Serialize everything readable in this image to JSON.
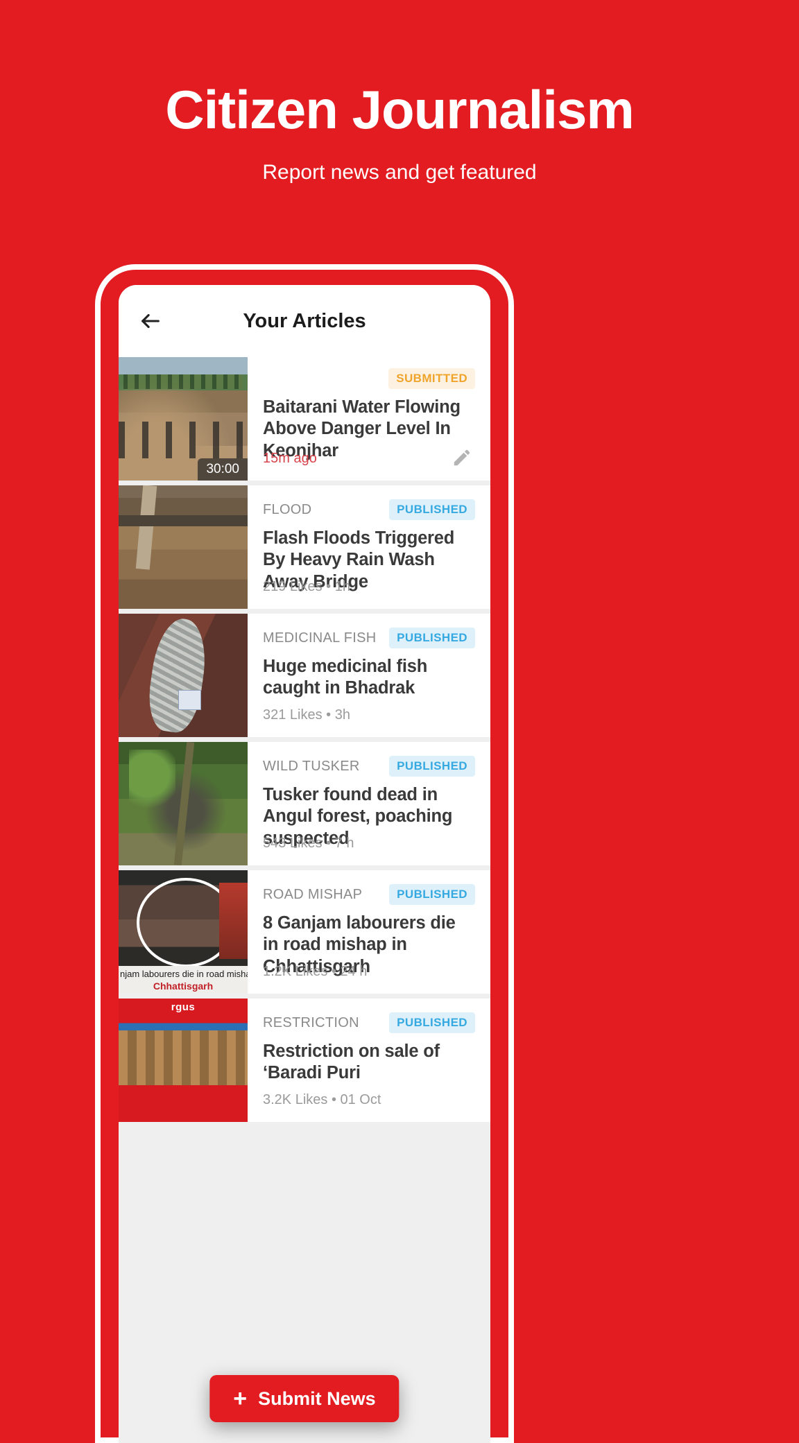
{
  "promo": {
    "title": "Citizen Journalism",
    "subtitle": "Report news and get featured"
  },
  "colors": {
    "brand_red": "#E21C21",
    "published_text": "#36A9E1",
    "published_bg": "#DEF1FB",
    "submitted_text": "#F0A42B",
    "submitted_bg": "#FDF2E2",
    "time_red": "#D8434C"
  },
  "app": {
    "back_icon": "arrow-left-icon",
    "title": "Your Articles",
    "submit_button": {
      "label": "Submit News",
      "icon": "plus-icon"
    }
  },
  "articles": [
    {
      "category": "",
      "status": "SUBMITTED",
      "status_type": "submitted",
      "headline": "Baitarani Water Flowing Above Danger Level In Keonjhar",
      "meta": "15m ago",
      "meta_style": "time-red",
      "duration": "30:00",
      "has_edit": true,
      "edit_icon": "pencil-icon",
      "thumb_class": "img-river"
    },
    {
      "category": "FLOOD",
      "status": "PUBLISHED",
      "status_type": "published",
      "headline": "Flash Floods Triggered By Heavy Rain Wash Away Bridge",
      "meta": "219 Likes • 1h",
      "meta_style": "",
      "duration": "",
      "has_edit": false,
      "thumb_class": "img-flood"
    },
    {
      "category": "MEDICINAL FISH",
      "status": "PUBLISHED",
      "status_type": "published",
      "headline": "Huge medicinal fish caught in Bhadrak",
      "meta": "321 Likes • 3h",
      "meta_style": "",
      "duration": "",
      "has_edit": false,
      "thumb_class": "img-fish"
    },
    {
      "category": "WILD TUSKER",
      "status": "PUBLISHED",
      "status_type": "published",
      "headline": "Tusker found dead in Angul forest, poaching suspected",
      "meta": "543 Likes • 7 h",
      "meta_style": "",
      "duration": "",
      "has_edit": false,
      "thumb_class": "img-forest"
    },
    {
      "category": "ROAD MISHAP",
      "status": "PUBLISHED",
      "status_type": "published",
      "headline": "8 Ganjam labourers die in road mishap in Chhattisgarh",
      "meta": "1.2K Likes • 24 h",
      "meta_style": "",
      "duration": "",
      "has_edit": false,
      "thumb_class": "img-road",
      "thumb_caption": "njam labourers die in road mishap in",
      "thumb_caption_highlight": "Chhattisgarh"
    },
    {
      "category": "RESTRICTION",
      "status": "PUBLISHED",
      "status_type": "published",
      "headline": "Restriction on sale of ‘Baradi Puri",
      "meta": "3.2K Likes • 01 Oct",
      "meta_style": "",
      "duration": "",
      "has_edit": false,
      "thumb_class": "img-pots",
      "thumb_logo": "rgus"
    }
  ]
}
